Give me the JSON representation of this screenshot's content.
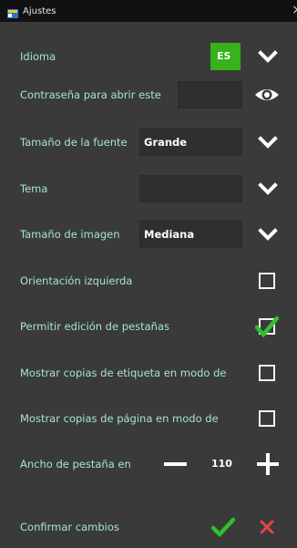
{
  "window": {
    "title": "Ajustes",
    "close_glyph": "×"
  },
  "rows": {
    "language": {
      "label": "Idioma",
      "value": "ES"
    },
    "password": {
      "label": "Contraseña para abrir este"
    },
    "font_size": {
      "label": "Tamaño de la fuente",
      "value": "Grande"
    },
    "theme": {
      "label": "Tema",
      "value": ""
    },
    "image_size": {
      "label": "Tamaño de imagen",
      "value": "Mediana"
    },
    "left_orientation": {
      "label": "Orientación izquierda",
      "checked": false
    },
    "allow_tab_edit": {
      "label": "Permitir edición de pestañas",
      "checked": true
    },
    "show_label_copies": {
      "label": "Mostrar copias de etiqueta en modo de",
      "checked": false
    },
    "show_page_copies": {
      "label": "Mostrar copias de página en modo de",
      "checked": false
    },
    "tab_width": {
      "label": "Ancho de pestaña en",
      "value": "110"
    },
    "confirm": {
      "label": "Confirmar cambios"
    }
  },
  "colors": {
    "background": "#3a3a3a",
    "label_text": "#a6e6c8",
    "accent_green": "#37b21a",
    "check_green": "#2fc12f",
    "cancel_red": "#e4474c"
  },
  "icons": [
    "window-app-icon",
    "close-icon",
    "chevron-down-icon",
    "eye-icon",
    "checkbox-icon",
    "minus-icon",
    "plus-icon",
    "checkmark-icon",
    "x-icon"
  ]
}
